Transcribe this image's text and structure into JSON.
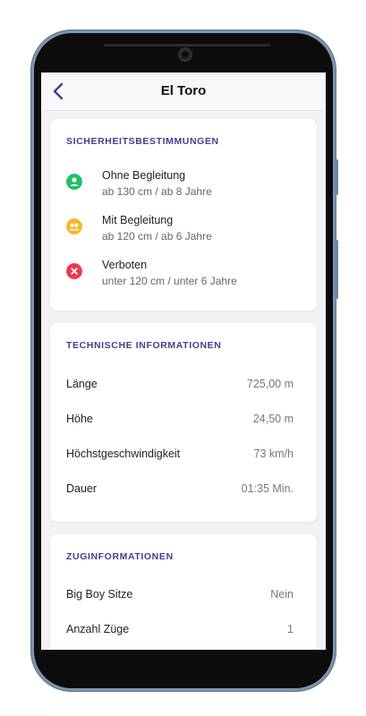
{
  "header": {
    "title": "El Toro"
  },
  "safety": {
    "title": "SICHERHEITSBESTIMMUNGEN",
    "items": [
      {
        "label": "Ohne Begleitung",
        "sub": "ab 130 cm / ab 8 Jahre",
        "icon": "person-icon",
        "color": "#22c064"
      },
      {
        "label": "Mit Begleitung",
        "sub": "ab 120 cm / ab 6 Jahre",
        "icon": "group-icon",
        "color": "#f5b82a"
      },
      {
        "label": "Verboten",
        "sub": "unter 120 cm / unter 6 Jahre",
        "icon": "close-icon",
        "color": "#ea3a53"
      }
    ]
  },
  "technical": {
    "title": "TECHNISCHE INFORMATIONEN",
    "rows": [
      {
        "label": "Länge",
        "value": "725,00 m"
      },
      {
        "label": "Höhe",
        "value": "24,50 m"
      },
      {
        "label": "Höchstgeschwindigkeit",
        "value": "73 km/h"
      },
      {
        "label": "Dauer",
        "value": "01:35 Min."
      }
    ]
  },
  "train": {
    "title": "ZUGINFORMATIONEN",
    "rows": [
      {
        "label": "Big Boy Sitze",
        "value": "Nein"
      },
      {
        "label": "Anzahl Züge",
        "value": "1"
      }
    ]
  },
  "colors": {
    "accent": "#4b3a92",
    "background": "#f2f2f5"
  }
}
